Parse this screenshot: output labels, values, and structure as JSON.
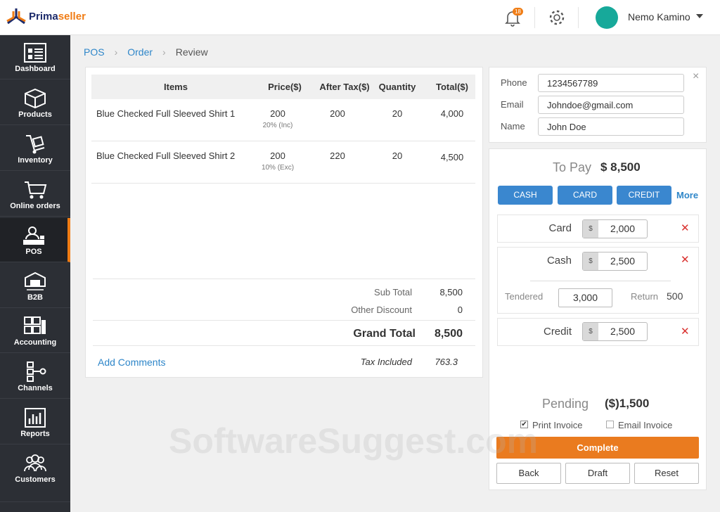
{
  "app": {
    "logo_a": "Prima",
    "logo_b": "seller",
    "notifications": "18",
    "user": "Nemo Kamino"
  },
  "sidebar": [
    "Dashboard",
    "Products",
    "Inventory",
    "Online orders",
    "POS",
    "B2B",
    "Accounting",
    "Channels",
    "Reports",
    "Customers"
  ],
  "breadcrumb": [
    "POS",
    "Order",
    "Review"
  ],
  "table": {
    "headers": [
      "Items",
      "Price($)",
      "After Tax($)",
      "Quantity",
      "Total($)"
    ],
    "rows": [
      {
        "item": "Blue Checked Full Sleeved Shirt 1",
        "price": "200",
        "tax": "20% (Inc)",
        "after_tax": "200",
        "qty": "20",
        "total": "4,000"
      },
      {
        "item": "Blue Checked Full Sleeved Shirt 2",
        "price": "200",
        "tax": "10% (Exc)",
        "after_tax": "220",
        "qty": "20",
        "total": "4,500"
      }
    ]
  },
  "totals": {
    "sub_total_label": "Sub Total",
    "sub_total": "8,500",
    "discount_label": "Other Discount",
    "discount": "0",
    "grand_label": "Grand Total",
    "grand": "8,500",
    "add_comments": "Add Comments",
    "tax_label": "Tax Included",
    "tax": "763.3"
  },
  "customer": {
    "phone_label": "Phone",
    "phone": "1234567789",
    "email_label": "Email",
    "email": "Johndoe@gmail.com",
    "name_label": "Name",
    "name": "John Doe"
  },
  "payment": {
    "to_pay_label": "To Pay",
    "to_pay": "$ 8,500",
    "buttons": [
      "CASH",
      "CARD",
      "CREDIT"
    ],
    "more": "More",
    "currency": "$",
    "card_label": "Card",
    "card": "2,000",
    "cash_label": "Cash",
    "cash": "2,500",
    "tendered_label": "Tendered",
    "tendered": "3,000",
    "return_label": "Return",
    "return": "500",
    "credit_label": "Credit",
    "credit": "2,500",
    "pending_label": "Pending",
    "pending": "($)1,500",
    "print_invoice": "Print Invoice",
    "email_invoice": "Email Invoice",
    "complete": "Complete",
    "back": "Back",
    "draft": "Draft",
    "reset": "Reset"
  },
  "watermark": "SoftwareSuggest.com"
}
